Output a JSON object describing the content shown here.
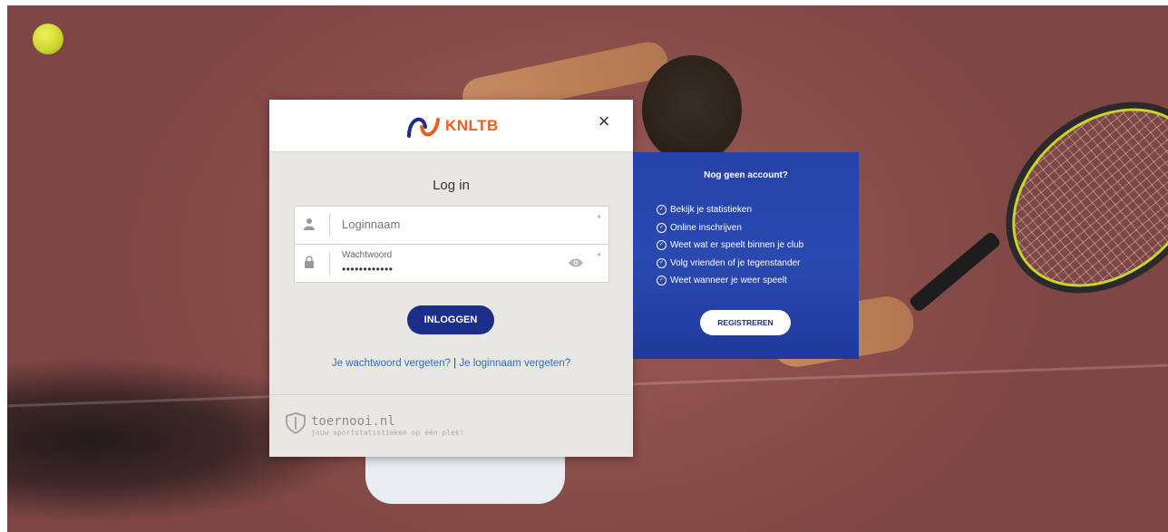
{
  "brand": {
    "name": "KNLTB",
    "color": "#e8601c"
  },
  "modal": {
    "close_label": "×",
    "title": "Log in",
    "username": {
      "placeholder": "Loginnaam",
      "required_mark": "*",
      "icon": "user-icon"
    },
    "password": {
      "label": "Wachtwoord",
      "value": "••••••••••••",
      "required_mark": "*",
      "icon": "lock-icon",
      "toggle_icon": "eye-icon"
    },
    "login_button": "INLOGGEN",
    "forgot_password": "Je wachtwoord vergeten?",
    "separator": "|",
    "forgot_username": "Je loginnaam vergeten?",
    "footer": {
      "name": "toernooi.nl",
      "tagline": "jouw sportstatistieken op één plek!",
      "icon": "shield-icon"
    }
  },
  "panel": {
    "title": "Nog geen account?",
    "items": [
      "Bekijk je statistieken",
      "Online inschrijven",
      "Weet wat er speelt binnen je club",
      "Volg vrienden of je tegenstander",
      "Weet wanneer je weer speelt"
    ],
    "register_button": "REGISTREREN",
    "color": "#2442a8"
  }
}
